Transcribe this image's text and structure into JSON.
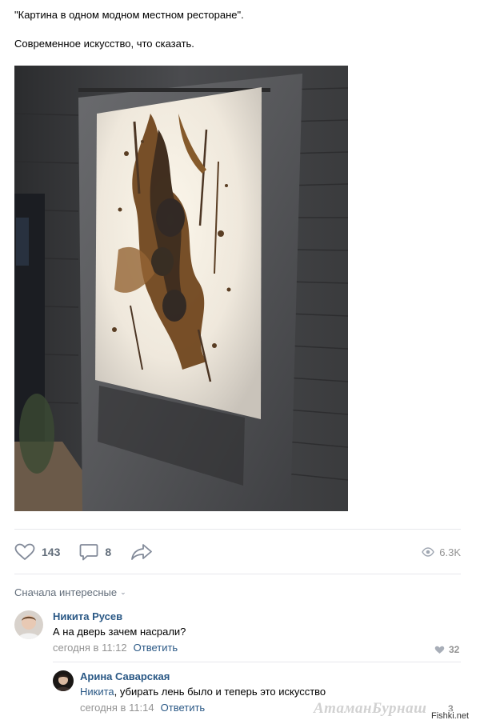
{
  "post": {
    "line1": "\"Картина в одном модном местном ресторане\".",
    "line2": "Современное искусство, что сказать."
  },
  "actions": {
    "likes": "143",
    "comments": "8",
    "views": "6.3K"
  },
  "comments_sort": "Сначала интересные",
  "comments": [
    {
      "author": "Никита Русев",
      "text": "А на дверь зачем насрали?",
      "date": "сегодня в 11:12",
      "reply_label": "Ответить",
      "likes": "32"
    },
    {
      "author": "Арина Саварская",
      "mention": "Никита",
      "text": ", убирать лень было и теперь это искусство",
      "date": "сегодня в 11:14",
      "reply_label": "Ответить",
      "likes": "3"
    }
  ],
  "watermark": {
    "text": "АтаманБурнаш",
    "site": "Fishki.net"
  },
  "colors": {
    "link": "#2a5885",
    "muted": "#939393",
    "action": "#626d7a",
    "divider": "#e7e8ec"
  }
}
